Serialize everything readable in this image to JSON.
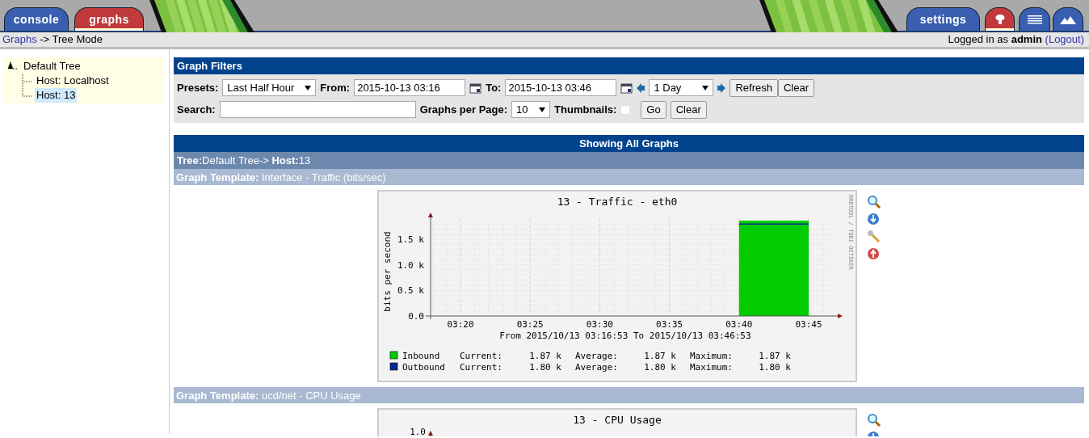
{
  "top_tabs": [
    {
      "label": "console",
      "color": "#3a5fb0",
      "selected": false
    },
    {
      "label": "graphs",
      "color": "#c0393b",
      "selected": true
    }
  ],
  "right_tabs": [
    {
      "kind": "text",
      "label": "settings",
      "color": "#3a5fb0",
      "selected": false
    },
    {
      "kind": "tree",
      "color": "#c0393b",
      "selected": true
    },
    {
      "kind": "list",
      "color": "#3a5fb0",
      "selected": false
    },
    {
      "kind": "preview",
      "color": "#3a5fb0",
      "selected": false
    }
  ],
  "breadcrumb": {
    "link": "Graphs",
    "rest": "-> Tree Mode"
  },
  "login": {
    "prefix": "Logged in as",
    "user": "admin",
    "logout": "(Logout)"
  },
  "tree": {
    "label": "Default Tree",
    "children": [
      {
        "label": "Host: Localhost",
        "selected": false
      },
      {
        "label": "Host: 13",
        "selected": true
      }
    ]
  },
  "filters": {
    "title": "Graph Filters",
    "presets_label": "Presets:",
    "preset": "Last Half Hour",
    "from_label": "From:",
    "from": "2015-10-13 03:16",
    "to_label": "To:",
    "to": "2015-10-13 03:46",
    "span": "1 Day",
    "refresh": "Refresh",
    "clear": "Clear",
    "search_label": "Search:",
    "per_page_label": "Graphs per Page:",
    "per_page": "10",
    "thumbnails_label": "Thumbnails:",
    "thumbnails": false,
    "go": "Go",
    "clear2": "Clear"
  },
  "showing": "Showing All Graphs",
  "tree_path": {
    "tree_label": "Tree:",
    "tree": "Default Tree->",
    "host_label": "Host:",
    "host": "13"
  },
  "templates": [
    {
      "label": "Graph Template:",
      "name": "Interface - Traffic (bits/sec)",
      "graph": {
        "subtitle": "From 2015/10/13 03:16:53 To 2015/10/13 03:46:53",
        "watermark": "RRDTOOL / TOBI OETIKER",
        "chart_data": {
          "type": "area",
          "title": "13 - Traffic - eth0",
          "ylabel": "bits per second",
          "categories": [
            "03:20",
            "03:25",
            "03:30",
            "03:35",
            "03:40",
            "03:45"
          ],
          "series": [
            {
              "name": "Inbound",
              "color": "#00cc00",
              "values": [
                null,
                null,
                null,
                null,
                1.87,
                1.87
              ]
            },
            {
              "name": "Outbound",
              "color": "#002a97",
              "type": "line",
              "values": [
                null,
                null,
                null,
                null,
                1.8,
                1.8
              ]
            }
          ],
          "ylim": [
            0,
            1.9
          ],
          "grid": true,
          "legend": "bottom",
          "yticks": [
            {
              "value": 0,
              "label": "0.0"
            },
            {
              "value": 0.5,
              "label": "0.5 k"
            },
            {
              "value": 1,
              "label": "1.0 k"
            },
            {
              "value": 1.5,
              "label": "1.5 k"
            }
          ]
        },
        "legend": [
          {
            "cur_label": "Current:",
            "cur": "1.87 k",
            "avg_label": "Average:",
            "avg": "1.87 k",
            "max_label": "Maximum:",
            "max": "1.87 k"
          },
          {
            "cur_label": "Current:",
            "cur": "1.80 k",
            "avg_label": "Average:",
            "avg": "1.80 k",
            "max_label": "Maximum:",
            "max": "1.80 k"
          }
        ]
      }
    },
    {
      "label": "Graph Template:",
      "name": "ucd/net - CPU Usage",
      "graph": {
        "title": "13 - CPU Usage",
        "top_tick": "1.0"
      }
    }
  ]
}
